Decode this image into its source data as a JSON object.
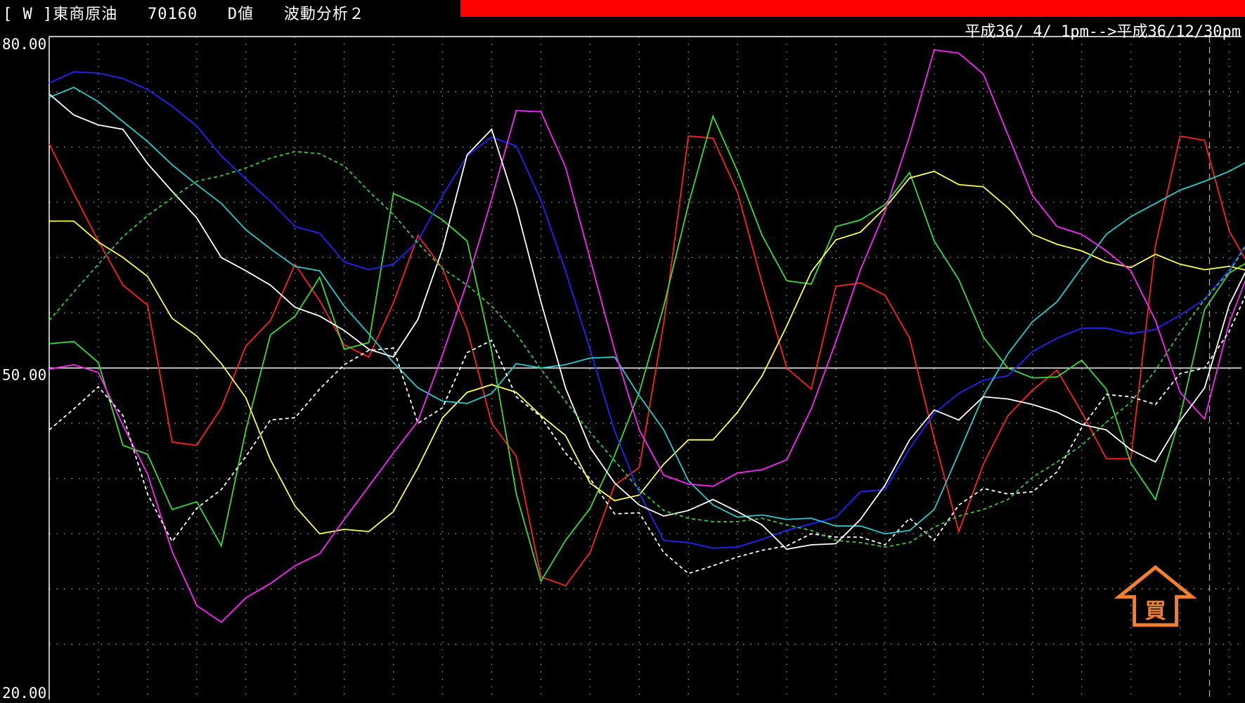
{
  "header": {
    "title": "[ W ]東商原油   70160   D値   波動分析２",
    "range_text": "平成36/ 4/ 1pm-->平成36/12/30pm"
  },
  "colors": {
    "background": "#000000",
    "alert_bar": "#ff0000",
    "buy_signal": "#f47f2e",
    "series": [
      "#ff2020",
      "#33dd33",
      "#ffff44",
      "#2222ff",
      "#22cccc",
      "#ff22ff",
      "#ffffff",
      "#ffffff",
      "#33cc33"
    ]
  },
  "signal": {
    "label": "買",
    "icon": "buy-arrow-icon",
    "x": 45
  },
  "chart_data": {
    "type": "line",
    "yticks": [
      "80.00",
      "50.00",
      "20.00"
    ],
    "ylim": [
      20,
      80
    ],
    "reference_line": 50,
    "x": [
      0,
      1,
      2,
      3,
      4,
      5,
      6,
      7,
      8,
      9,
      10,
      11,
      12,
      13,
      14,
      15,
      16,
      17,
      18,
      19,
      20,
      21,
      22,
      23,
      24,
      25,
      26,
      27,
      28,
      29,
      30,
      31,
      32,
      33,
      34,
      35,
      36,
      37,
      38,
      39,
      40,
      41,
      42,
      43,
      44,
      45,
      46,
      47,
      48,
      49
    ],
    "xlim": [
      0,
      48.5
    ],
    "series": [
      {
        "values": [
          70.3,
          65.8,
          61.5,
          57.5,
          55.7,
          43.3,
          43.0,
          46.4,
          52.0,
          54.3,
          59.4,
          56.1,
          52.1,
          51.0,
          55.9,
          62.0,
          59.0,
          53.5,
          45.0,
          42.0,
          31.1,
          30.3,
          33.3,
          39.4,
          41.0,
          54.1,
          71.0,
          70.8,
          65.9,
          57.7,
          50.0,
          48.1,
          57.4,
          57.7,
          56.6,
          52.7,
          43.6,
          35.2,
          41.3,
          45.7,
          48.0,
          49.8,
          46.0,
          41.8,
          41.8,
          61.1,
          71.0,
          70.6,
          62.4,
          58.5
        ],
        "color": "#ff2020",
        "dash": false
      },
      {
        "values": [
          52.2,
          52.4,
          50.5,
          43.0,
          42.2,
          37.2,
          37.9,
          33.9,
          44.4,
          53.0,
          54.7,
          58.2,
          51.7,
          52.3,
          65.8,
          64.8,
          63.4,
          61.5,
          51.5,
          38.6,
          30.7,
          34.4,
          37.3,
          42.1,
          47.8,
          55.6,
          64.8,
          72.8,
          67.8,
          62.0,
          57.9,
          57.6,
          62.8,
          63.4,
          64.8,
          67.7,
          61.5,
          58.0,
          52.8,
          50.0,
          49.1,
          49.2,
          50.7,
          48.1,
          41.4,
          38.1,
          45.6,
          55.3,
          58.6,
          59.9
        ],
        "color": "#33dd33",
        "dash": false
      },
      {
        "values": [
          63.3,
          63.3,
          61.4,
          60.0,
          58.3,
          54.5,
          52.9,
          50.4,
          47.3,
          41.7,
          37.5,
          35.0,
          35.4,
          35.2,
          37.0,
          41.0,
          45.5,
          47.8,
          48.5,
          47.8,
          45.7,
          43.9,
          39.6,
          38.0,
          38.5,
          41.3,
          43.5,
          43.5,
          46.0,
          49.3,
          53.8,
          58.7,
          61.6,
          62.3,
          64.5,
          67.2,
          67.8,
          66.6,
          66.4,
          64.5,
          62.1,
          61.2,
          60.6,
          59.6,
          59.1,
          60.3,
          59.4,
          58.9,
          59.2,
          58.7
        ],
        "color": "#ffff44",
        "dash": false
      },
      {
        "values": [
          75.8,
          76.8,
          76.7,
          76.2,
          75.2,
          73.7,
          71.9,
          69.2,
          67.1,
          65.1,
          62.8,
          62.2,
          59.6,
          58.9,
          59.4,
          61.5,
          65.6,
          69.2,
          70.9,
          70.1,
          65.2,
          58.8,
          51.7,
          44.3,
          38.7,
          34.4,
          34.2,
          33.7,
          33.8,
          34.5,
          35.3,
          35.9,
          36.5,
          38.8,
          39.0,
          42.7,
          45.9,
          47.7,
          48.9,
          49.3,
          51.5,
          52.7,
          53.6,
          53.6,
          53.1,
          53.5,
          54.8,
          56.2,
          58.9,
          62.2
        ],
        "color": "#2222ff",
        "dash": false
      },
      {
        "values": [
          74.5,
          75.4,
          74.1,
          72.3,
          70.5,
          68.4,
          66.6,
          64.9,
          62.5,
          60.8,
          59.2,
          58.8,
          55.6,
          53.1,
          50.5,
          48.2,
          47.0,
          46.8,
          47.7,
          50.4,
          50.0,
          50.3,
          50.9,
          51.0,
          47.5,
          44.4,
          39.8,
          37.6,
          36.5,
          36.7,
          36.3,
          36.4,
          35.7,
          35.7,
          35.0,
          35.3,
          37.2,
          42.3,
          47.5,
          51.3,
          54.2,
          56.0,
          59.1,
          62.1,
          63.7,
          64.9,
          66.1,
          66.9,
          67.8,
          69.0
        ],
        "color": "#22cccc",
        "dash": false
      },
      {
        "values": [
          49.9,
          50.3,
          49.6,
          44.8,
          40.4,
          33.4,
          28.5,
          27.0,
          29.2,
          30.5,
          32.1,
          33.2,
          36.3,
          39.3,
          42.3,
          45.2,
          51.2,
          57.8,
          65.3,
          73.3,
          73.2,
          68.2,
          59.9,
          51.6,
          44.4,
          40.3,
          39.5,
          39.3,
          40.5,
          40.8,
          41.7,
          46.3,
          52.4,
          58.9,
          64.2,
          71.0,
          78.8,
          78.5,
          76.6,
          71.1,
          65.6,
          62.8,
          62.1,
          60.6,
          58.8,
          54.3,
          47.8,
          45.4,
          54.1,
          59.9
        ],
        "color": "#ff22ff",
        "dash": false
      },
      {
        "values": [
          74.8,
          72.9,
          72.0,
          71.6,
          68.5,
          66.0,
          63.6,
          60.0,
          58.8,
          57.5,
          55.5,
          54.7,
          53.4,
          51.7,
          51.0,
          54.4,
          60.8,
          69.3,
          71.6,
          64.6,
          56.0,
          48.2,
          42.8,
          39.6,
          37.6,
          36.6,
          37.1,
          38.1,
          37.0,
          35.8,
          33.6,
          34.0,
          34.1,
          36.3,
          39.4,
          43.5,
          46.2,
          45.3,
          47.4,
          47.2,
          46.7,
          46.0,
          44.9,
          44.4,
          42.6,
          41.5,
          45.2,
          48.2,
          55.7,
          60.2
        ],
        "color": "#ffffff",
        "dash": false
      },
      {
        "values": [
          44.4,
          46.3,
          48.3,
          45.7,
          38.6,
          34.3,
          37.3,
          39.0,
          42.0,
          45.3,
          45.5,
          48.1,
          50.3,
          51.6,
          51.8,
          45.0,
          46.4,
          51.4,
          52.5,
          47.4,
          45.6,
          42.3,
          40.0,
          36.8,
          36.9,
          33.3,
          31.4,
          32.1,
          32.9,
          33.5,
          33.9,
          35.0,
          34.7,
          34.7,
          34.0,
          36.4,
          34.4,
          37.6,
          39.1,
          38.6,
          38.8,
          40.6,
          44.6,
          47.6,
          47.4,
          46.7,
          49.5,
          50.0,
          53.3,
          58.2
        ],
        "color": "#ffffff",
        "dash": true
      },
      {
        "values": [
          54.3,
          56.9,
          59.4,
          61.9,
          63.8,
          65.4,
          66.9,
          67.4,
          68.1,
          69.0,
          69.6,
          69.4,
          68.3,
          66.0,
          63.9,
          61.3,
          59.0,
          57.5,
          55.6,
          53.1,
          49.9,
          47.0,
          44.2,
          41.6,
          39.0,
          37.1,
          36.4,
          36.1,
          36.1,
          36.4,
          35.8,
          35.3,
          34.4,
          34.2,
          33.8,
          34.2,
          35.6,
          36.6,
          37.2,
          38.1,
          40.1,
          41.5,
          43.0,
          45.1,
          46.9,
          49.8,
          53.2,
          56.2,
          58.7,
          62.2
        ],
        "color": "#33cc33",
        "dash": true
      }
    ]
  }
}
